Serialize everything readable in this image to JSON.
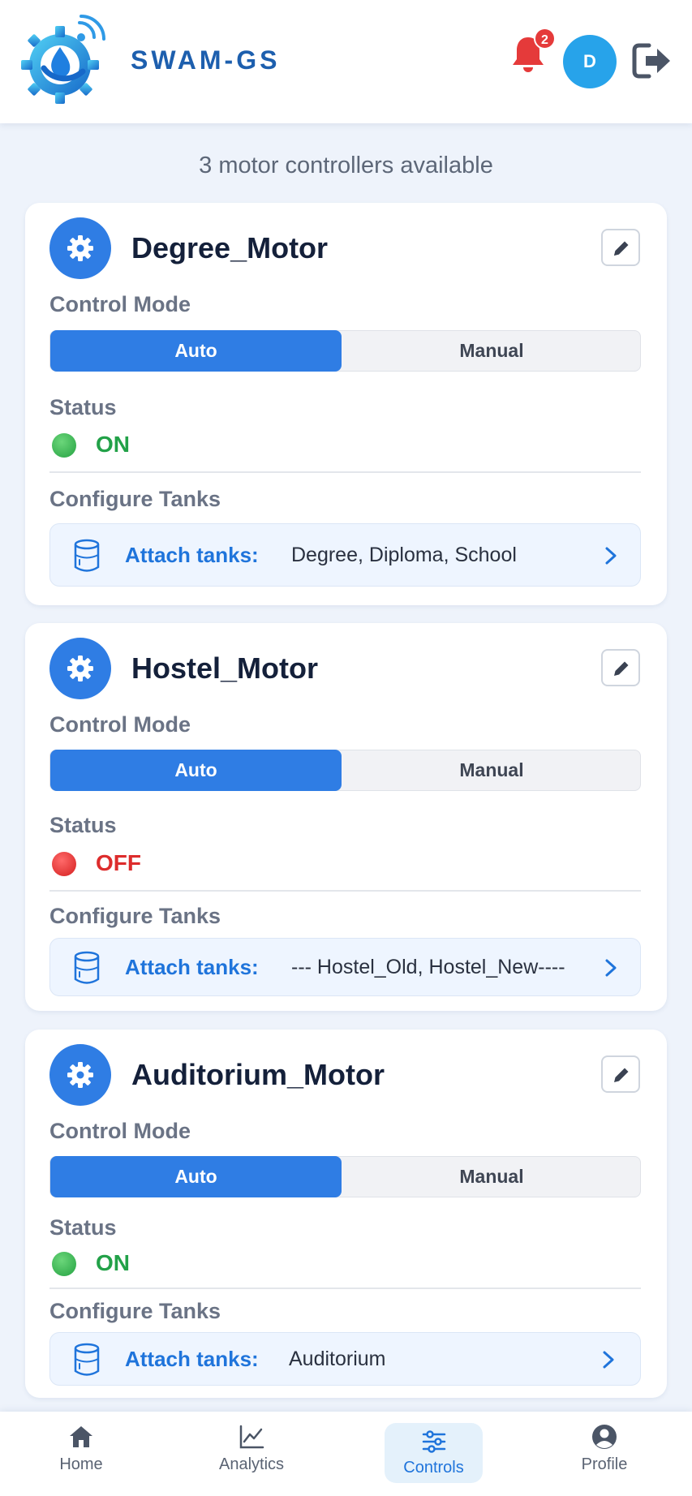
{
  "header": {
    "brand": "SWAM-GS",
    "notification_count": "2",
    "avatar_initial": "D"
  },
  "subtitle": "3 motor controllers available",
  "labels": {
    "control_mode": "Control Mode",
    "status": "Status",
    "configure_tanks": "Configure Tanks",
    "attach_tanks": "Attach tanks:",
    "auto": "Auto",
    "manual": "Manual"
  },
  "motors": [
    {
      "name": "Degree_Motor",
      "mode": "Auto",
      "status": "ON",
      "tanks": "Degree, Diploma, School"
    },
    {
      "name": "Hostel_Motor",
      "mode": "Auto",
      "status": "OFF",
      "tanks": "--- Hostel_Old, Hostel_New----"
    },
    {
      "name": "Auditorium_Motor",
      "mode": "Auto",
      "status": "ON",
      "tanks": "Auditorium"
    }
  ],
  "nav": {
    "items": [
      {
        "label": "Home",
        "icon": "home-icon"
      },
      {
        "label": "Analytics",
        "icon": "chart-line-icon"
      },
      {
        "label": "Controls",
        "icon": "sliders-icon"
      },
      {
        "label": "Profile",
        "icon": "user-circle-icon"
      }
    ],
    "active": "Controls"
  },
  "colors": {
    "accent": "#2f7de4",
    "brand": "#1d5fae",
    "status_on": "#22a148",
    "status_off": "#dd2c2c",
    "badge": "#e53a3a",
    "avatar": "#27a3ea"
  }
}
